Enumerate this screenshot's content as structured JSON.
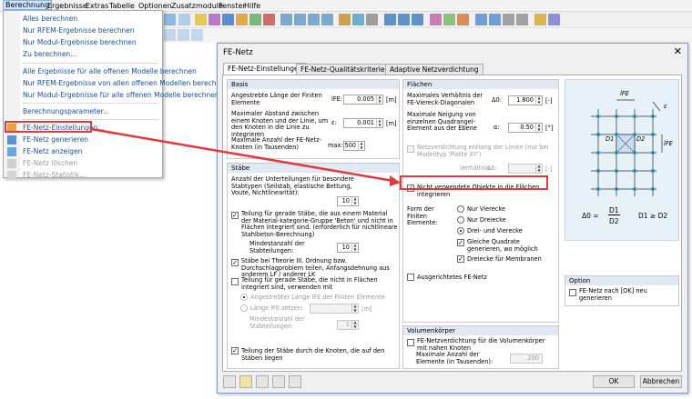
{
  "menubar": [
    "Berechnung",
    "Ergebnisse",
    "Extras",
    "Tabelle",
    "Optionen",
    "Zusatzmodule",
    "Fenster",
    "Hilfe"
  ],
  "menu": {
    "items": [
      {
        "label": "Alles berechnen",
        "icon": "none",
        "disabled": false
      },
      {
        "label": "Nur RFEM-Ergebnisse berechnen",
        "icon": "none",
        "disabled": false
      },
      {
        "label": "Nur Modul-Ergebnisse berechnen",
        "icon": "none",
        "disabled": false
      },
      {
        "label": "Zu berechnen...",
        "icon": "none",
        "disabled": false
      },
      {
        "label": "Alle Ergebnisse für alle offenen Modelle berechnen",
        "icon": "none",
        "disabled": false
      },
      {
        "label": "Nur RFEM-Ergebnisse von allen offenen Modellen berechnen",
        "icon": "none",
        "disabled": false
      },
      {
        "label": "Nur Modul-Ergebnisse für alle offenen Modelle berechnen",
        "icon": "none",
        "disabled": false
      },
      {
        "label": "Berechnungsparameter...",
        "icon": "none",
        "disabled": false
      },
      {
        "label": "FE-Netz-Einstellungen...",
        "icon": "mesh-settings-icon",
        "disabled": false
      },
      {
        "label": "FE-Netz generieren",
        "icon": "mesh-generate-icon",
        "disabled": false
      },
      {
        "label": "FE-Netz anzeigen",
        "icon": "mesh-show-icon",
        "disabled": false
      },
      {
        "label": "FE-Netz löschen",
        "icon": "mesh-delete-icon",
        "disabled": true
      },
      {
        "label": "FE-Netz-Statistik...",
        "icon": "mesh-statistics-icon",
        "disabled": true
      }
    ]
  },
  "dialog": {
    "title": "FE-Netz",
    "tabs": [
      "FE-Netz-Einstellungen",
      "FE-Netz-Qualitätskriterien",
      "Adaptive Netzverdichtung"
    ],
    "basis": {
      "header": "Basis",
      "l1": "Angestrebte Länge der Finiten Elemente",
      "s1": "lFE:",
      "v1": "0.005",
      "u1": "[m]",
      "l2": "Maximaler Abstand zwischen einem Knoten und der Linie, um den Knoten in die Linie zu integrieren",
      "s2": "ε:",
      "v2": "0.001",
      "u2": "[m]",
      "l3": "Maximale Anzahl der FE-Netz-Knoten (in Tausenden)",
      "s3": "max:",
      "v3": "500"
    },
    "staebe": {
      "header": "Stäbe",
      "l1": "Anzahl der Unterteilungen für besondere Stabtypen (Seilstab, elastische Bettung, Voute, Nichtlinearität):",
      "v1": "10",
      "c1": "Teilung für gerade Stäbe, die aus einem Material der Material-kategorie-Gruppe 'Beton' und nicht in Flächen integriert sind. (erforderlich für nichtlineare Stahlbeton-Berechnung)",
      "l2": "Mindestanzahl der Stabteilungen:",
      "v2": "10",
      "c2": "Stäbe bei Theorie III. Ordnung bzw. Durchschlagproblem teilen, Anfangsdehnung aus anderem LF / anderer LK",
      "c3": "Teilung für gerade Stäbe, die nicht in Flächen integriert sind, verwenden mit",
      "r1": "Angestrebter Länge lFE der Finiten Elemente",
      "r2": "Länge lFE setzen:",
      "u2": "[m]",
      "l3": "Mindestanzahl der Stabteilungen:",
      "v3": "1",
      "c4": "Teilung der Stäbe durch die Knoten, die auf den Stäben liegen"
    },
    "flaechen": {
      "header": "Flächen",
      "l1": "Maximales Verhältnis der FE-Viereck-Diagonalen",
      "s1": "Δ0:",
      "v1": "1.800",
      "u1": "[-]",
      "l2": "Maximale Neigung von einzelnen Quadrangel-Element aus der Ebene",
      "s2": "α:",
      "v2": "0.50",
      "u2": "[°]",
      "c1": "Netzverdichtung entlang der Linien (nur bei Modelltyp 'Platte XY')",
      "l3": "Verhältnis",
      "s3": "Δb:",
      "u3": "[-]",
      "c2": "Nicht verwendete Objekte in die Flächen integrieren",
      "form_label": "Form der Finiten Elemente:",
      "r1": "Nur Vierecke",
      "r2": "Nur Dreiecke",
      "r3": "Drei- und Vierecke",
      "c3": "Gleiche Quadrate generieren, wo möglich",
      "c4": "Dreiecke für Membranen",
      "c5": "Ausgerichtetes FE-Netz"
    },
    "volumen": {
      "header": "Volumenkörper",
      "c1": "FE-Netzverdichtung für die Volumenkörper mit nahen Knoten",
      "l1": "Maximale Anzahl der Elemente (in Tausenden):",
      "v1": "200"
    },
    "option": {
      "header": "Option",
      "c1": "FE-Netz nach [OK] neu generieren"
    },
    "figure": {
      "lfe": "lFE",
      "eps": "ε",
      "d1": "D1",
      "d2": "D2",
      "formula_lhs": "Δ0 =",
      "formula_num": "D1",
      "formula_den": "D2",
      "formula_rhs": "D1 ≥ D2"
    },
    "ok": "OK",
    "cancel": "Abbrechen"
  },
  "colors": {
    "highlight": "#e0393e",
    "accent": "#dfe8f3"
  }
}
